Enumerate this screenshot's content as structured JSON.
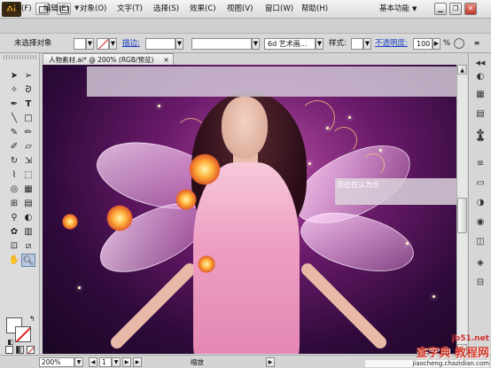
{
  "app": {
    "logo": "Ai"
  },
  "menu": [
    "文件(F)",
    "编辑(E)",
    "对象(O)",
    "文字(T)",
    "选择(S)",
    "效果(C)",
    "视图(V)",
    "窗口(W)",
    "帮助(H)"
  ],
  "workspace": {
    "label": "基本功能"
  },
  "window_buttons": {
    "minimize": "▁",
    "restore": "❐",
    "close": "✕"
  },
  "control_bar": {
    "selection_status": "未选择对象",
    "stroke_label": "描边:",
    "brush_value": "6d 艺术画...",
    "style_label": "样式:",
    "opacity_label": "不透明度:",
    "opacity_value": "100",
    "opacity_unit": "%"
  },
  "document": {
    "tab_title": "人物素材.ai* @ 200% (RGB/预览)",
    "canvas_overlay_text": "而往在认为乐"
  },
  "status_bar": {
    "zoom": "200%",
    "page": "1",
    "info": "缩放"
  },
  "watermark": {
    "line1": "查字典 教程网",
    "line2": "jiaocheng.chazidian.com",
    "corner": "jb51.net"
  },
  "colors": {
    "stroke_none": "#d22222",
    "fill": "#ffffff"
  }
}
